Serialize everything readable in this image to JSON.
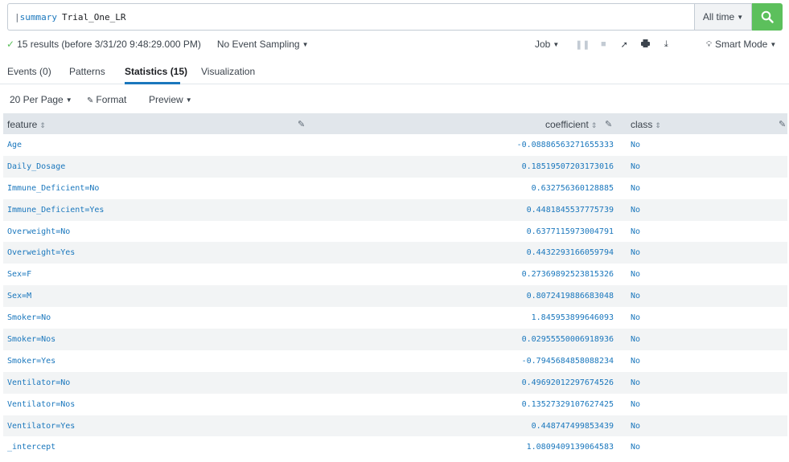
{
  "search": {
    "pipe": "|",
    "command": "summary",
    "argument": "Trial_One_LR",
    "time_range": "All time"
  },
  "status": {
    "results": "15 results (before 3/31/20 9:48:29.000 PM)",
    "sampling": "No Event Sampling",
    "job": "Job",
    "mode": "Smart Mode"
  },
  "tabs": [
    {
      "label": "Events (0)"
    },
    {
      "label": "Patterns"
    },
    {
      "label": "Statistics (15)"
    },
    {
      "label": "Visualization"
    }
  ],
  "toolbar": {
    "per_page": "20 Per Page",
    "format": "Format",
    "preview": "Preview"
  },
  "table": {
    "headers": {
      "feature": "feature",
      "coefficient": "coefficient",
      "class": "class"
    },
    "rows": [
      {
        "feature": "Age",
        "coefficient": "-0.08886563271655333",
        "class": "No"
      },
      {
        "feature": "Daily_Dosage",
        "coefficient": "0.18519507203173016",
        "class": "No"
      },
      {
        "feature": "Immune_Deficient=No",
        "coefficient": "0.632756360128885",
        "class": "No"
      },
      {
        "feature": "Immune_Deficient=Yes",
        "coefficient": "0.4481845537775739",
        "class": "No"
      },
      {
        "feature": "Overweight=No",
        "coefficient": "0.6377115973004791",
        "class": "No"
      },
      {
        "feature": "Overweight=Yes",
        "coefficient": "0.4432293166059794",
        "class": "No"
      },
      {
        "feature": "Sex=F",
        "coefficient": "0.27369892523815326",
        "class": "No"
      },
      {
        "feature": "Sex=M",
        "coefficient": "0.8072419886683048",
        "class": "No"
      },
      {
        "feature": "Smoker=No",
        "coefficient": "1.845953899646093",
        "class": "No"
      },
      {
        "feature": "Smoker=Nos",
        "coefficient": "0.02955550006918936",
        "class": "No"
      },
      {
        "feature": "Smoker=Yes",
        "coefficient": "-0.7945684858088234",
        "class": "No"
      },
      {
        "feature": "Ventilator=No",
        "coefficient": "0.49692012297674526",
        "class": "No"
      },
      {
        "feature": "Ventilator=Nos",
        "coefficient": "0.13527329107627425",
        "class": "No"
      },
      {
        "feature": "Ventilator=Yes",
        "coefficient": "0.448747499853439",
        "class": "No"
      },
      {
        "feature": "_intercept",
        "coefficient": "1.0809409139064583",
        "class": "No"
      }
    ]
  },
  "colors": {
    "accent": "#1a77bd",
    "search_button": "#5cc05c",
    "header_bg": "#e1e6eb"
  }
}
